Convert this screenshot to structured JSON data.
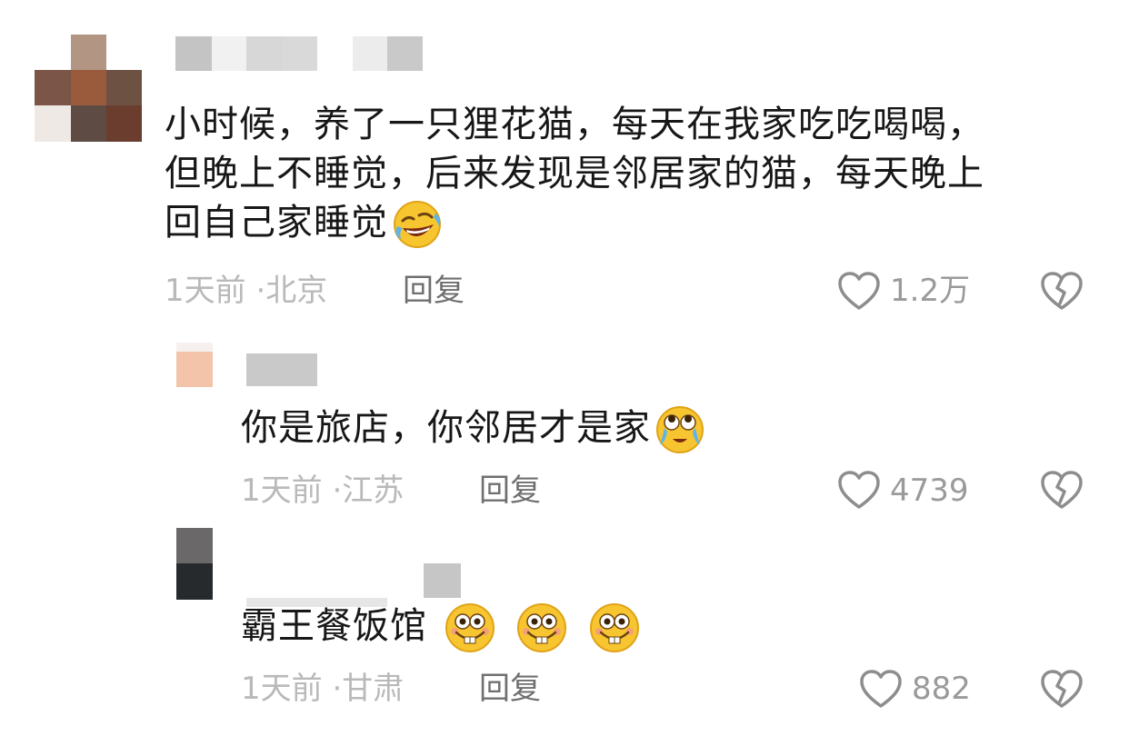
{
  "comments": [
    {
      "text_lines": [
        "小时候，养了一只狸花猫，每天在我家吃吃喝喝，",
        "但晚上不睡觉，后来发现是邻居家的猫，每天晚上",
        "回自己家睡觉"
      ],
      "time": "1天前",
      "location": "北京",
      "reply_label": "回复",
      "likes": "1.2万",
      "emoji": "rolling-laughing-emoji"
    },
    {
      "text_lines": [
        "你是旅店，你邻居才是家"
      ],
      "time": "1天前",
      "location": "江苏",
      "reply_label": "回复",
      "likes": "4739",
      "emoji": "teary-looking-up-emoji"
    },
    {
      "text_lines": [
        "霸王餐饭馆"
      ],
      "time": "1天前",
      "location": "甘肃",
      "reply_label": "回复",
      "likes": "882",
      "emoji": "buck-tooth-grin-emoji"
    }
  ],
  "meta_separator": "·",
  "icons": {
    "like": "heart-outline-icon",
    "dislike": "broken-heart-icon"
  }
}
